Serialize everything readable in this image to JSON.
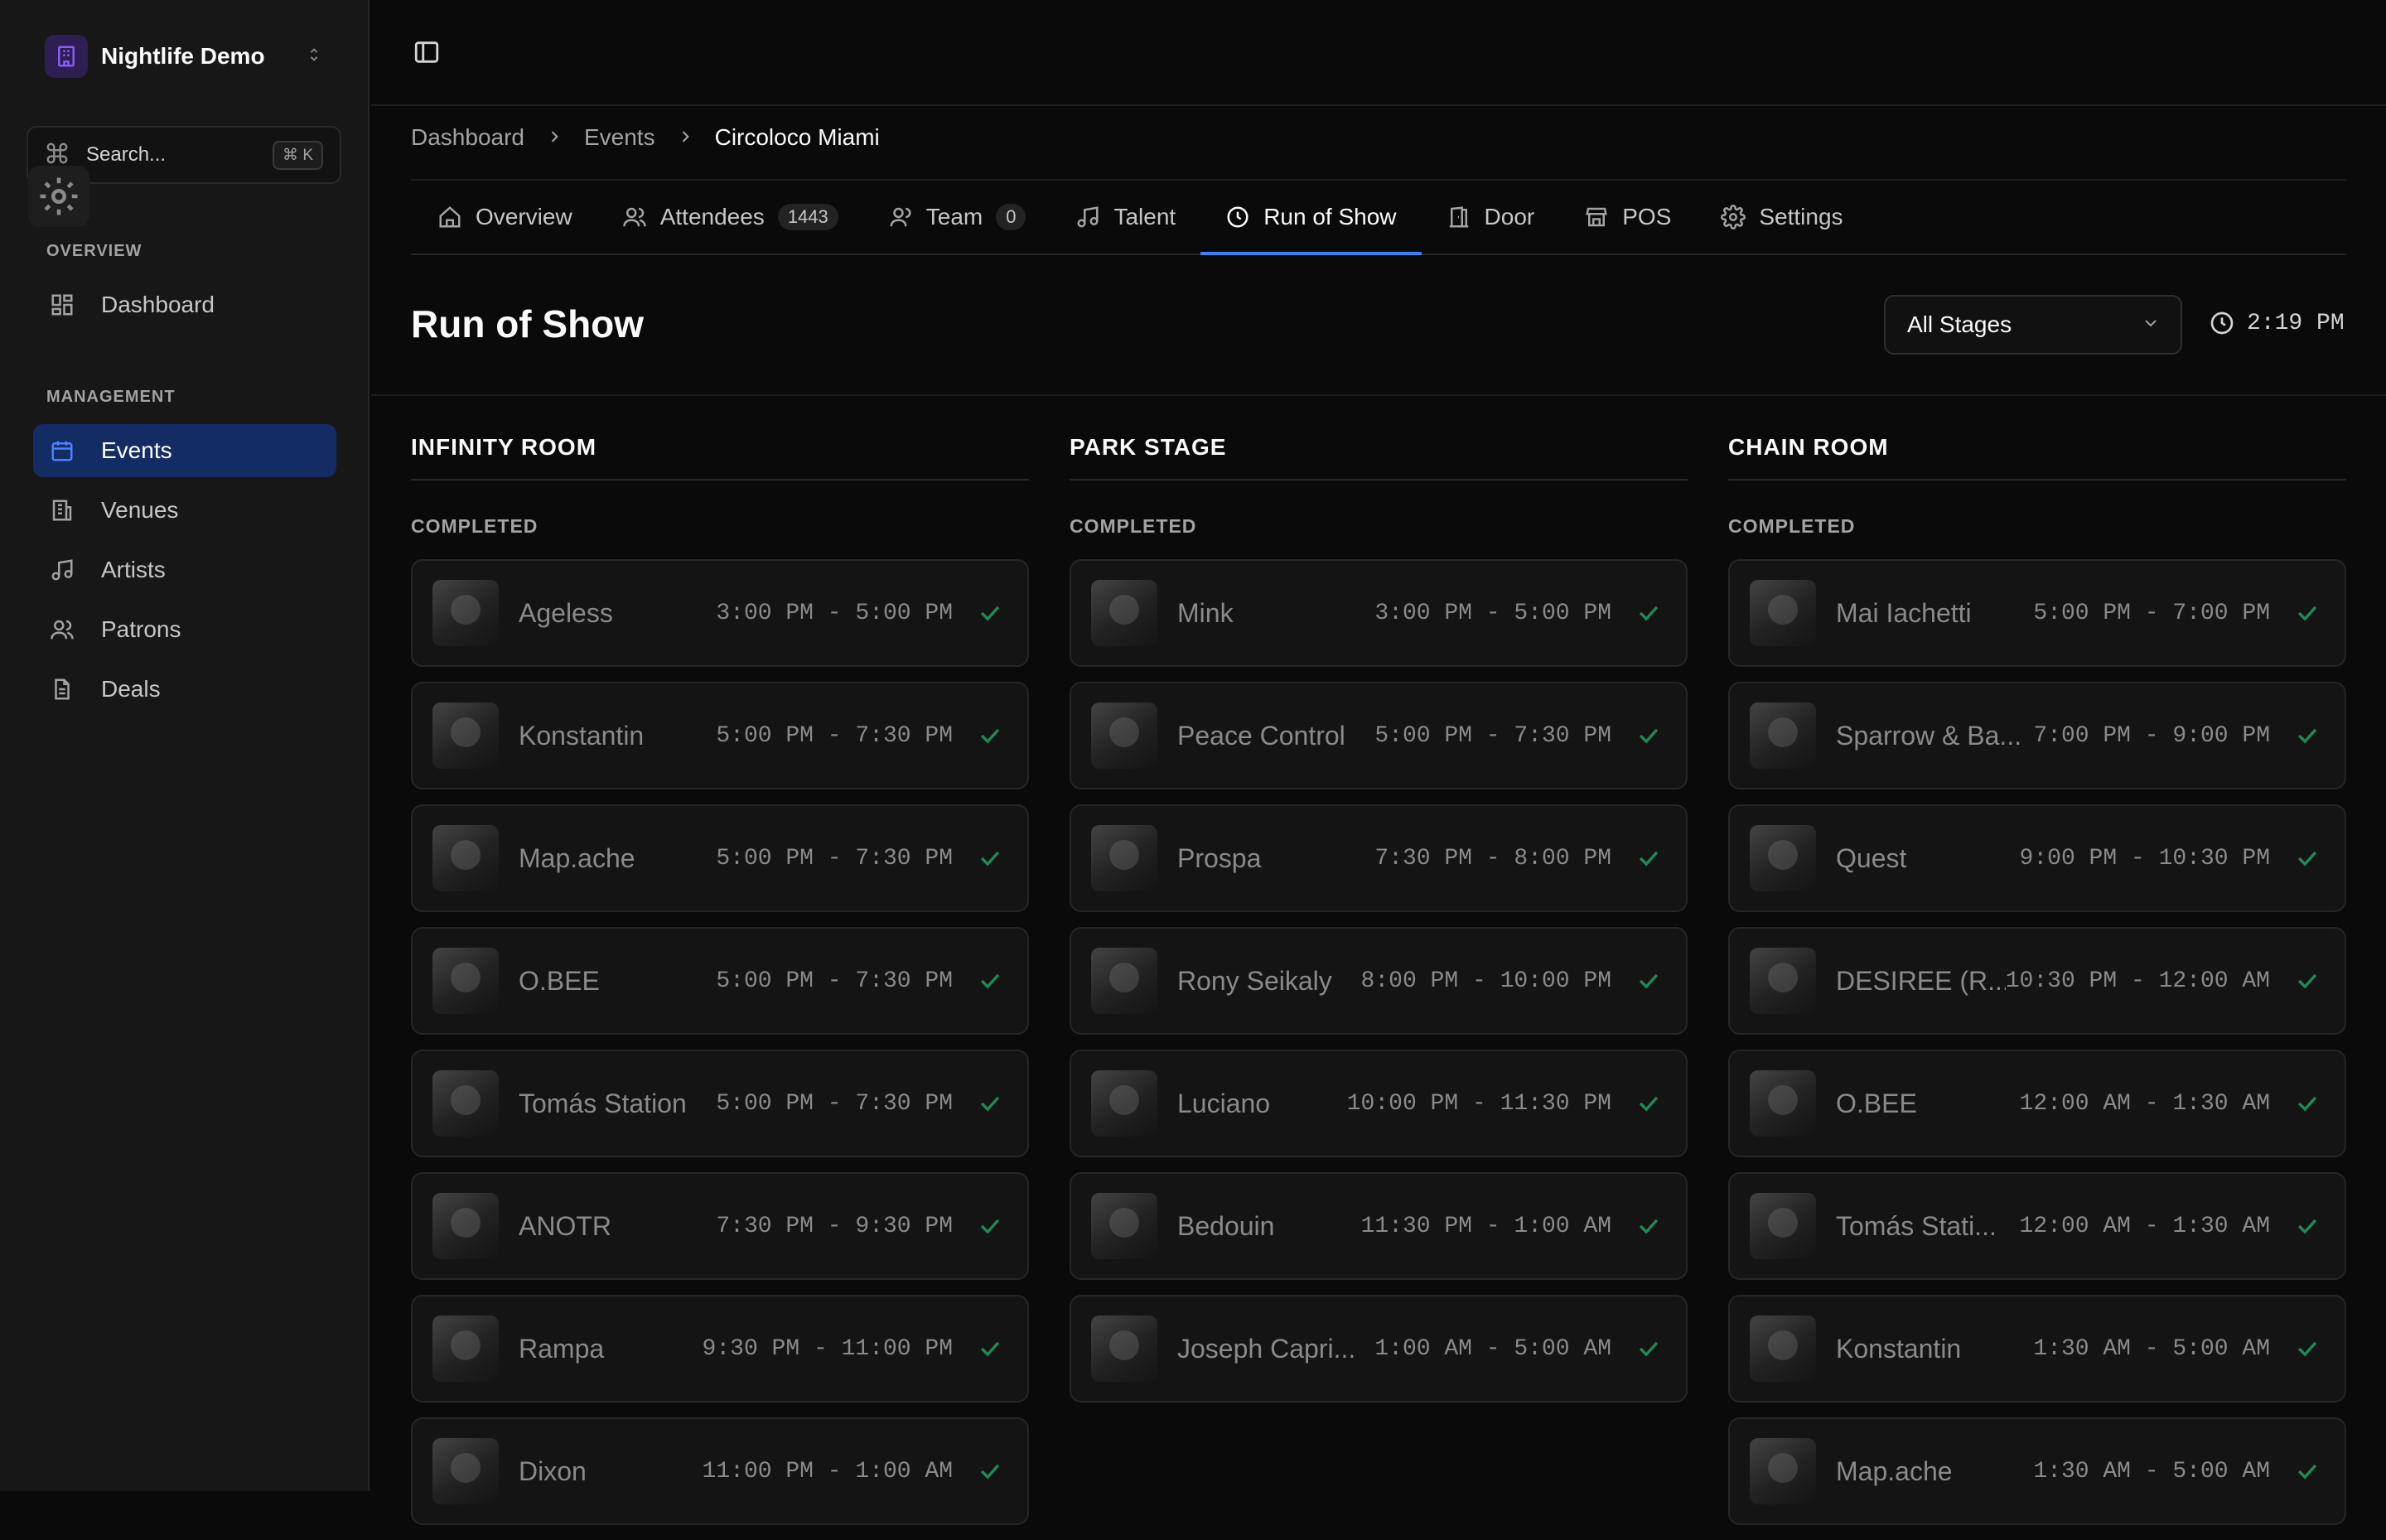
{
  "workspace": {
    "name": "Nightlife Demo"
  },
  "search": {
    "placeholder": "Search...",
    "shortcut": "⌘ K"
  },
  "sidebar": {
    "groups": [
      {
        "label": "OVERVIEW",
        "items": [
          {
            "label": "Dashboard",
            "icon": "dashboard-icon"
          }
        ]
      },
      {
        "label": "MANAGEMENT",
        "items": [
          {
            "label": "Events",
            "icon": "calendar-icon",
            "active": true
          },
          {
            "label": "Venues",
            "icon": "building-icon"
          },
          {
            "label": "Artists",
            "icon": "music-icon"
          },
          {
            "label": "Patrons",
            "icon": "users-icon"
          },
          {
            "label": "Deals",
            "icon": "document-icon"
          }
        ]
      }
    ]
  },
  "breadcrumb": [
    "Dashboard",
    "Events",
    "Circoloco Miami"
  ],
  "tabs": [
    {
      "label": "Overview",
      "icon": "home-icon"
    },
    {
      "label": "Attendees",
      "icon": "users-icon",
      "badge": "1443"
    },
    {
      "label": "Team",
      "icon": "user-icon",
      "badge": "0"
    },
    {
      "label": "Talent",
      "icon": "music-note-icon"
    },
    {
      "label": "Run of Show",
      "icon": "clock-icon",
      "active": true
    },
    {
      "label": "Door",
      "icon": "door-icon"
    },
    {
      "label": "POS",
      "icon": "store-icon"
    },
    {
      "label": "Settings",
      "icon": "gear-icon"
    }
  ],
  "page": {
    "title": "Run of Show",
    "stage_filter": "All Stages",
    "current_time": "2:19 PM"
  },
  "stages": [
    {
      "name": "INFINITY ROOM",
      "section": "COMPLETED",
      "sets": [
        {
          "artist": "Ageless",
          "time": "3:00 PM - 5:00 PM"
        },
        {
          "artist": "Konstantin",
          "time": "5:00 PM - 7:30 PM"
        },
        {
          "artist": "Map.ache",
          "time": "5:00 PM - 7:30 PM"
        },
        {
          "artist": "O.BEE",
          "time": "5:00 PM - 7:30 PM"
        },
        {
          "artist": "Tomás Station",
          "time": "5:00 PM - 7:30 PM"
        },
        {
          "artist": "ANOTR",
          "time": "7:30 PM - 9:30 PM"
        },
        {
          "artist": "Rampa",
          "time": "9:30 PM - 11:00 PM"
        },
        {
          "artist": "Dixon",
          "time": "11:00 PM - 1:00 AM"
        }
      ]
    },
    {
      "name": "PARK STAGE",
      "section": "COMPLETED",
      "sets": [
        {
          "artist": "Mink",
          "time": "3:00 PM - 5:00 PM"
        },
        {
          "artist": "Peace Control",
          "time": "5:00 PM - 7:30 PM"
        },
        {
          "artist": "Prospa",
          "time": "7:30 PM - 8:00 PM"
        },
        {
          "artist": "Rony Seikaly",
          "time": "8:00 PM - 10:00 PM"
        },
        {
          "artist": "Luciano",
          "time": "10:00 PM - 11:30 PM"
        },
        {
          "artist": "Bedouin",
          "time": "11:30 PM - 1:00 AM"
        },
        {
          "artist": "Joseph Capri...",
          "time": "1:00 AM - 5:00 AM"
        }
      ]
    },
    {
      "name": "CHAIN ROOM",
      "section": "COMPLETED",
      "sets": [
        {
          "artist": "Mai Iachetti",
          "time": "5:00 PM - 7:00 PM"
        },
        {
          "artist": "Sparrow & Ba...",
          "time": "7:00 PM - 9:00 PM"
        },
        {
          "artist": "Quest",
          "time": "9:00 PM - 10:30 PM"
        },
        {
          "artist": "DESIREE (R...",
          "time": "10:30 PM - 12:00 AM"
        },
        {
          "artist": "O.BEE",
          "time": "12:00 AM - 1:30 AM"
        },
        {
          "artist": "Tomás Stati...",
          "time": "12:00 AM - 1:30 AM"
        },
        {
          "artist": "Konstantin",
          "time": "1:30 AM - 5:00 AM"
        },
        {
          "artist": "Map.ache",
          "time": "1:30 AM - 5:00 AM"
        }
      ]
    }
  ],
  "colors": {
    "accent": "#3b82f6",
    "active_nav_bg": "#132c63",
    "check": "#1f8a58",
    "workspace_logo": "#7c4dff"
  }
}
